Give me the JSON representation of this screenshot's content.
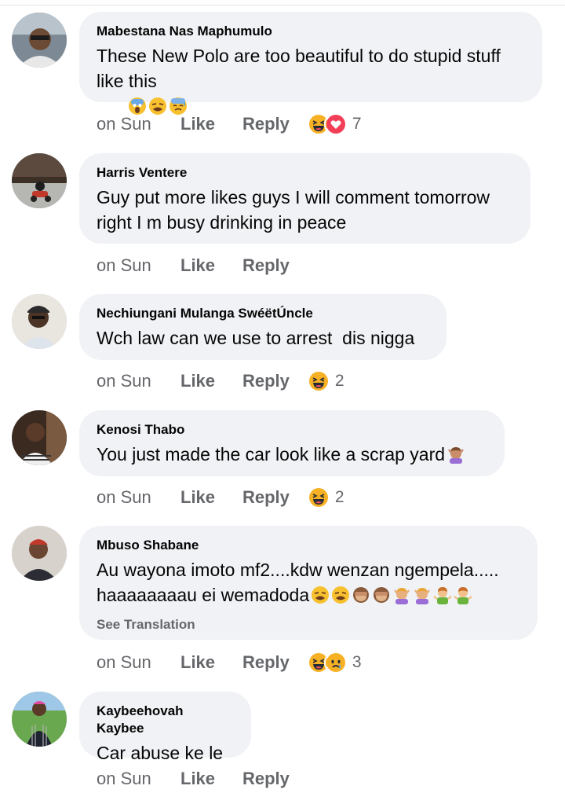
{
  "colors": {
    "bubble": "#f0f2f5",
    "meta": "#65676b",
    "haha": "#f7b125",
    "love": "#f33e58"
  },
  "actions": {
    "like": "Like",
    "reply": "Reply",
    "see_translation": "See Translation"
  },
  "comments": [
    {
      "author": "Mabestana Nas Maphumulo",
      "text": "These New Polo are too beautiful to do stupid stuff like this",
      "emojis": [
        "screaming-face",
        "weary-face",
        "sweat-face"
      ],
      "time": "on Sun",
      "reactions": [
        "haha",
        "love"
      ],
      "reaction_count": "7"
    },
    {
      "author": "Harris Ventere",
      "text": "Guy put more likes guys I will comment tomorrow right I m busy drinking in peace",
      "time": "on Sun"
    },
    {
      "author": "Nechiungani Mulanga SwéëtÚncle",
      "text": "Wch law can we use to arrest  dis nigga",
      "time": "on Sun",
      "reactions": [
        "haha"
      ],
      "reaction_count": "2"
    },
    {
      "author": "Kenosi Thabo",
      "text": "You just made the car look like a scrap yard",
      "emojis": [
        "person-gesturing-no"
      ],
      "time": "on Sun",
      "reactions": [
        "haha"
      ],
      "reaction_count": "2"
    },
    {
      "author": "Mbuso Shabane",
      "text": "Au wayona imoto mf2....kdw wenzan ngempela..... haaaaaaaau ei wemadoda",
      "emojis": [
        "weary-face",
        "weary-face",
        "see-no-evil-monkey",
        "see-no-evil-monkey",
        "person-gesturing-no",
        "person-gesturing-no",
        "person-shrugging",
        "person-shrugging"
      ],
      "see_translation": true,
      "time": "on Sun",
      "reactions": [
        "haha",
        "sad"
      ],
      "reaction_count": "3"
    },
    {
      "author": "Kaybeehovah Kaybee",
      "text": "Car abuse ke le",
      "time": "on Sun"
    }
  ]
}
